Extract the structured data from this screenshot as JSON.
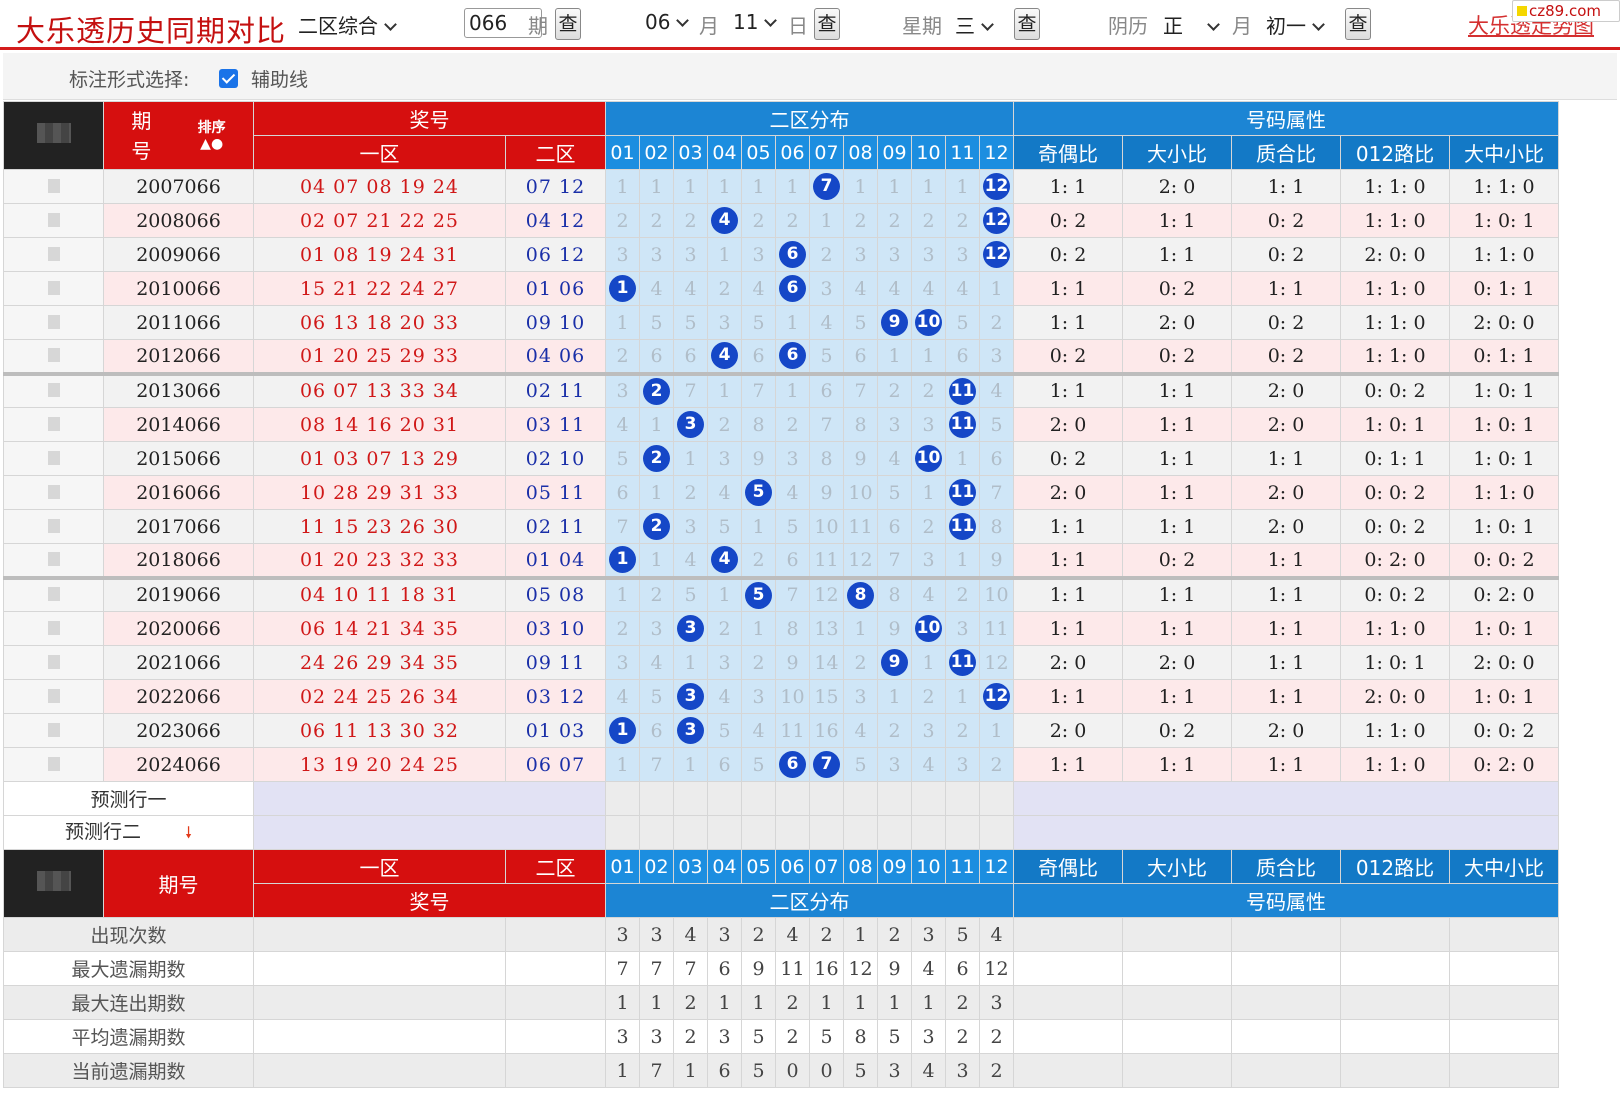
{
  "top": {
    "title": "大乐透历史同期对比",
    "zone_select": "二区综合",
    "issue_value": "066",
    "issue_label": "期",
    "query": "查",
    "month_value": "06",
    "month_label": "月",
    "day_value": "11",
    "day_label": "日",
    "week_label": "星期",
    "week_value": "三",
    "lunar_label": "阴历",
    "lunar_month_value": "正",
    "lunar_month_label": "月",
    "lunar_day_value": "初一",
    "link": "大乐透走势图",
    "badge": "cz89.com"
  },
  "options": {
    "label": "标注形式选择:",
    "checkbox_label": "辅助线",
    "checked": true
  },
  "header": {
    "issue": "期号",
    "issue_a": "期",
    "issue_b": "号",
    "sort": "排序",
    "prize": "奖号",
    "zone1": "一区",
    "zone2": "二区",
    "dist": "二区分布",
    "attr": "号码属性",
    "nums": [
      "01",
      "02",
      "03",
      "04",
      "05",
      "06",
      "07",
      "08",
      "09",
      "10",
      "11",
      "12"
    ],
    "attrs": [
      "奇偶比",
      "大小比",
      "质合比",
      "012路比",
      "大中小比"
    ]
  },
  "rows": [
    {
      "issue": "2007066",
      "front": "04 07 08 19 24",
      "back": "07 12",
      "dist": [
        "1",
        "1",
        "1",
        "1",
        "1",
        "1",
        "7",
        "1",
        "1",
        "1",
        "1",
        "12"
      ],
      "hits": [
        7,
        12
      ],
      "attrs": [
        "1: 1",
        "2: 0",
        "1: 1",
        "1: 1: 0",
        "1: 1: 0"
      ]
    },
    {
      "issue": "2008066",
      "front": "02 07 21 22 25",
      "back": "04 12",
      "dist": [
        "2",
        "2",
        "2",
        "4",
        "2",
        "2",
        "1",
        "2",
        "2",
        "2",
        "2",
        "12"
      ],
      "hits": [
        4,
        12
      ],
      "attrs": [
        "0: 2",
        "1: 1",
        "0: 2",
        "1: 1: 0",
        "1: 0: 1"
      ]
    },
    {
      "issue": "2009066",
      "front": "01 08 19 24 31",
      "back": "06 12",
      "dist": [
        "3",
        "3",
        "3",
        "1",
        "3",
        "6",
        "2",
        "3",
        "3",
        "3",
        "3",
        "12"
      ],
      "hits": [
        6,
        12
      ],
      "attrs": [
        "0: 2",
        "1: 1",
        "0: 2",
        "2: 0: 0",
        "1: 1: 0"
      ]
    },
    {
      "issue": "2010066",
      "front": "15 21 22 24 27",
      "back": "01 06",
      "dist": [
        "1",
        "4",
        "4",
        "2",
        "4",
        "6",
        "3",
        "4",
        "4",
        "4",
        "4",
        "1"
      ],
      "hits": [
        1,
        6
      ],
      "attrs": [
        "1: 1",
        "0: 2",
        "1: 1",
        "1: 1: 0",
        "0: 1: 1"
      ]
    },
    {
      "issue": "2011066",
      "front": "06 13 18 20 33",
      "back": "09 10",
      "dist": [
        "1",
        "5",
        "5",
        "3",
        "5",
        "1",
        "4",
        "5",
        "9",
        "10",
        "5",
        "2"
      ],
      "hits": [
        9,
        10
      ],
      "attrs": [
        "1: 1",
        "2: 0",
        "0: 2",
        "1: 1: 0",
        "2: 0: 0"
      ]
    },
    {
      "issue": "2012066",
      "front": "01 20 25 29 33",
      "back": "04 06",
      "dist": [
        "2",
        "6",
        "6",
        "4",
        "6",
        "6",
        "5",
        "6",
        "1",
        "1",
        "6",
        "3"
      ],
      "hits": [
        4,
        6
      ],
      "attrs": [
        "0: 2",
        "0: 2",
        "0: 2",
        "1: 1: 0",
        "0: 1: 1"
      ]
    },
    {
      "issue": "2013066",
      "front": "06 07 13 33 34",
      "back": "02 11",
      "dist": [
        "3",
        "2",
        "7",
        "1",
        "7",
        "1",
        "6",
        "7",
        "2",
        "2",
        "11",
        "4"
      ],
      "hits": [
        2,
        11
      ],
      "attrs": [
        "1: 1",
        "1: 1",
        "2: 0",
        "0: 0: 2",
        "1: 0: 1"
      ]
    },
    {
      "issue": "2014066",
      "front": "08 14 16 20 31",
      "back": "03 11",
      "dist": [
        "4",
        "1",
        "3",
        "2",
        "8",
        "2",
        "7",
        "8",
        "3",
        "3",
        "11",
        "5"
      ],
      "hits": [
        3,
        11
      ],
      "attrs": [
        "2: 0",
        "1: 1",
        "2: 0",
        "1: 0: 1",
        "1: 0: 1"
      ]
    },
    {
      "issue": "2015066",
      "front": "01 03 07 13 29",
      "back": "02 10",
      "dist": [
        "5",
        "2",
        "1",
        "3",
        "9",
        "3",
        "8",
        "9",
        "4",
        "10",
        "1",
        "6"
      ],
      "hits": [
        2,
        10
      ],
      "attrs": [
        "0: 2",
        "1: 1",
        "1: 1",
        "0: 1: 1",
        "1: 0: 1"
      ]
    },
    {
      "issue": "2016066",
      "front": "10 28 29 31 33",
      "back": "05 11",
      "dist": [
        "6",
        "1",
        "2",
        "4",
        "5",
        "4",
        "9",
        "10",
        "5",
        "1",
        "11",
        "7"
      ],
      "hits": [
        5,
        11
      ],
      "attrs": [
        "2: 0",
        "1: 1",
        "2: 0",
        "0: 0: 2",
        "1: 1: 0"
      ]
    },
    {
      "issue": "2017066",
      "front": "11 15 23 26 30",
      "back": "02 11",
      "dist": [
        "7",
        "2",
        "3",
        "5",
        "1",
        "5",
        "10",
        "11",
        "6",
        "2",
        "11",
        "8"
      ],
      "hits": [
        2,
        11
      ],
      "attrs": [
        "1: 1",
        "1: 1",
        "2: 0",
        "0: 0: 2",
        "1: 0: 1"
      ]
    },
    {
      "issue": "2018066",
      "front": "01 20 23 32 33",
      "back": "01 04",
      "dist": [
        "1",
        "1",
        "4",
        "4",
        "2",
        "6",
        "11",
        "12",
        "7",
        "3",
        "1",
        "9"
      ],
      "hits": [
        1,
        4
      ],
      "attrs": [
        "1: 1",
        "0: 2",
        "1: 1",
        "0: 2: 0",
        "0: 0: 2"
      ]
    },
    {
      "issue": "2019066",
      "front": "04 10 11 18 31",
      "back": "05 08",
      "dist": [
        "1",
        "2",
        "5",
        "1",
        "5",
        "7",
        "12",
        "8",
        "8",
        "4",
        "2",
        "10"
      ],
      "hits": [
        5,
        8
      ],
      "attrs": [
        "1: 1",
        "1: 1",
        "1: 1",
        "0: 0: 2",
        "0: 2: 0"
      ]
    },
    {
      "issue": "2020066",
      "front": "06 14 21 34 35",
      "back": "03 10",
      "dist": [
        "2",
        "3",
        "3",
        "2",
        "1",
        "8",
        "13",
        "1",
        "9",
        "10",
        "3",
        "11"
      ],
      "hits": [
        3,
        10
      ],
      "attrs": [
        "1: 1",
        "1: 1",
        "1: 1",
        "1: 1: 0",
        "1: 0: 1"
      ]
    },
    {
      "issue": "2021066",
      "front": "24 26 29 34 35",
      "back": "09 11",
      "dist": [
        "3",
        "4",
        "1",
        "3",
        "2",
        "9",
        "14",
        "2",
        "9",
        "1",
        "11",
        "12"
      ],
      "hits": [
        9,
        11
      ],
      "attrs": [
        "2: 0",
        "2: 0",
        "1: 1",
        "1: 0: 1",
        "2: 0: 0"
      ]
    },
    {
      "issue": "2022066",
      "front": "02 24 25 26 34",
      "back": "03 12",
      "dist": [
        "4",
        "5",
        "3",
        "4",
        "3",
        "10",
        "15",
        "3",
        "1",
        "2",
        "1",
        "12"
      ],
      "hits": [
        3,
        12
      ],
      "attrs": [
        "1: 1",
        "1: 1",
        "1: 1",
        "2: 0: 0",
        "1: 0: 1"
      ]
    },
    {
      "issue": "2023066",
      "front": "06 11 13 30 32",
      "back": "01 03",
      "dist": [
        "1",
        "6",
        "3",
        "5",
        "4",
        "11",
        "16",
        "4",
        "2",
        "3",
        "2",
        "1"
      ],
      "hits": [
        1,
        3
      ],
      "attrs": [
        "2: 0",
        "0: 2",
        "2: 0",
        "1: 1: 0",
        "0: 0: 2"
      ]
    },
    {
      "issue": "2024066",
      "front": "13 19 20 24 25",
      "back": "06 07",
      "dist": [
        "1",
        "7",
        "1",
        "6",
        "5",
        "6",
        "7",
        "5",
        "3",
        "4",
        "3",
        "2"
      ],
      "hits": [
        6,
        7
      ],
      "attrs": [
        "1: 1",
        "1: 1",
        "1: 1",
        "1: 1: 0",
        "0: 2: 0"
      ]
    }
  ],
  "predict": [
    "预测行一",
    "预测行二"
  ],
  "stats": [
    {
      "label": "出现次数",
      "values": [
        "3",
        "3",
        "4",
        "3",
        "2",
        "4",
        "2",
        "1",
        "2",
        "3",
        "5",
        "4"
      ]
    },
    {
      "label": "最大遗漏期数",
      "values": [
        "7",
        "7",
        "7",
        "6",
        "9",
        "11",
        "16",
        "12",
        "9",
        "4",
        "6",
        "12"
      ]
    },
    {
      "label": "最大连出期数",
      "values": [
        "1",
        "1",
        "2",
        "1",
        "1",
        "2",
        "1",
        "1",
        "1",
        "1",
        "2",
        "3"
      ]
    },
    {
      "label": "平均遗漏期数",
      "values": [
        "3",
        "3",
        "2",
        "3",
        "5",
        "2",
        "5",
        "8",
        "5",
        "3",
        "2",
        "2"
      ]
    },
    {
      "label": "当前遗漏期数",
      "values": [
        "1",
        "7",
        "1",
        "6",
        "5",
        "0",
        "0",
        "5",
        "3",
        "4",
        "3",
        "2"
      ]
    }
  ],
  "colors": {
    "red": "#d60f0f",
    "blue": "#1c85d4",
    "ball": "#1547c7",
    "dist_bg": "#cfe6f7"
  }
}
